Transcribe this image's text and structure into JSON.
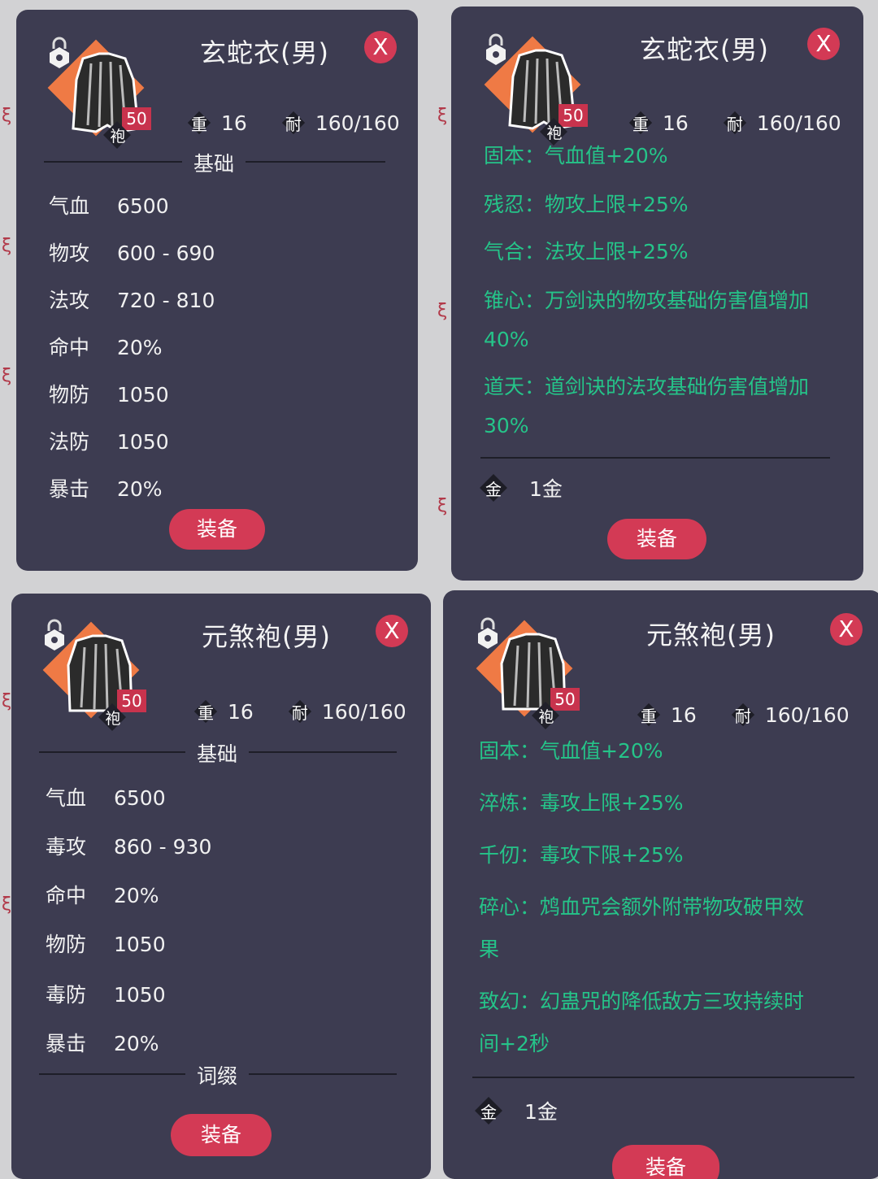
{
  "common": {
    "weight_label": "重",
    "weight": "16",
    "durability_label": "耐",
    "durability": "160/160",
    "level": "50",
    "category": "袍",
    "close_label": "X",
    "base_section": "基础",
    "affix_section": "词缀",
    "equip_button": "装备",
    "price_icon": "金",
    "price": "1金",
    "colors": {
      "panel": "#3d3c51",
      "accent": "#d33a55",
      "effect_text": "#25c489",
      "icon_bg": "#ef7a45"
    }
  },
  "panel1": {
    "title": "玄蛇衣(男)",
    "stats": [
      {
        "label": "气血",
        "value": "6500"
      },
      {
        "label": "物攻",
        "value": "600 - 690"
      },
      {
        "label": "法攻",
        "value": "720 - 810"
      },
      {
        "label": "命中",
        "value": "20%"
      },
      {
        "label": "物防",
        "value": "1050"
      },
      {
        "label": "法防",
        "value": "1050"
      },
      {
        "label": "暴击",
        "value": "20%"
      }
    ]
  },
  "panel2": {
    "title": "玄蛇衣(男)",
    "effects": [
      "固本：气血值+20%",
      "残忍：物攻上限+25%",
      "气合：法攻上限+25%",
      "锥心：万剑诀的物攻基础伤害值增加",
      "40%",
      "道天：道剑诀的法攻基础伤害值增加",
      "30%"
    ]
  },
  "panel3": {
    "title": "元煞袍(男)",
    "stats": [
      {
        "label": "气血",
        "value": "6500"
      },
      {
        "label": "毒攻",
        "value": "860 - 930"
      },
      {
        "label": "命中",
        "value": "20%"
      },
      {
        "label": "物防",
        "value": "1050"
      },
      {
        "label": "毒防",
        "value": "1050"
      },
      {
        "label": "暴击",
        "value": "20%"
      }
    ]
  },
  "panel4": {
    "title": "元煞袍(男)",
    "effects": [
      "固本：气血值+20%",
      "淬炼：毒攻上限+25%",
      "千仞：毒攻下限+25%",
      "碎心：鸩血咒会额外附带物攻破甲效",
      "果",
      "致幻：幻蛊咒的降低敌方三攻持续时",
      "间+2秒"
    ]
  }
}
